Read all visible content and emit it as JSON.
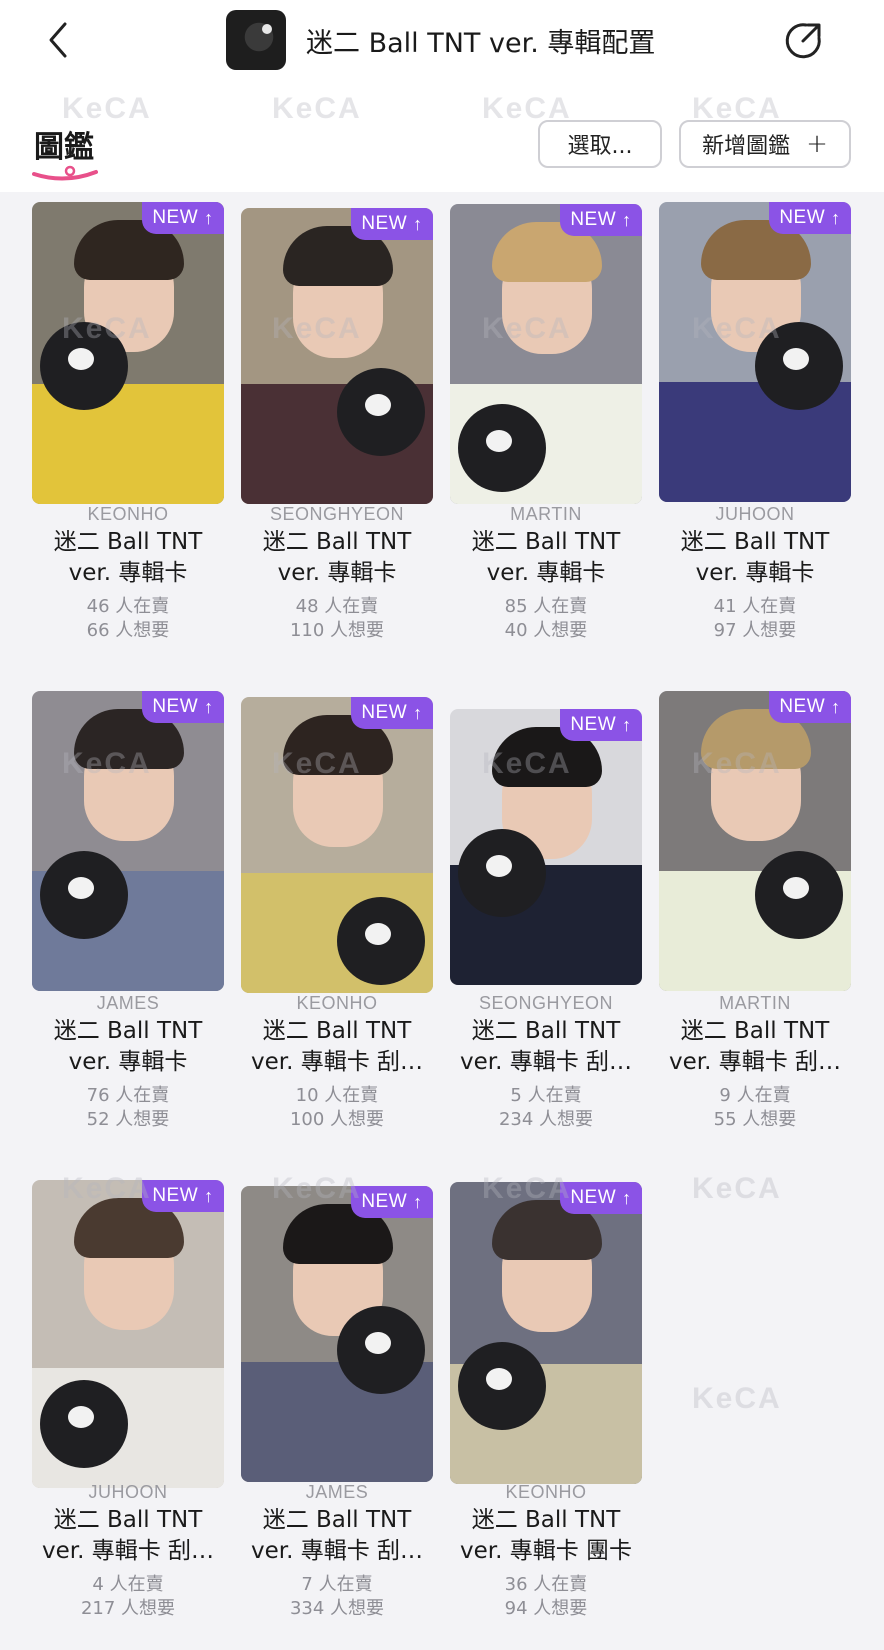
{
  "header": {
    "title": "迷二 Ball TNT ver. 專輯配置"
  },
  "toolbar": {
    "tab_label": "圖鑑",
    "select_label": "選取...",
    "add_label": "新增圖鑑",
    "add_symbol": "+"
  },
  "badge": {
    "text": "NEW",
    "arrow": "↑"
  },
  "watermark": "KeCA",
  "cards": [
    {
      "member": "KEONHO",
      "title1": "迷二 Ball TNT",
      "title2": "ver. 專輯卡",
      "selling": "46 人在賣",
      "wanting": "66 人想要"
    },
    {
      "member": "SEONGHYEON",
      "title1": "迷二 Ball TNT",
      "title2": "ver. 專輯卡",
      "selling": "48 人在賣",
      "wanting": "110 人想要"
    },
    {
      "member": "MARTIN",
      "title1": "迷二 Ball TNT",
      "title2": "ver. 專輯卡",
      "selling": "85 人在賣",
      "wanting": "40 人想要"
    },
    {
      "member": "JUHOON",
      "title1": "迷二 Ball TNT",
      "title2": "ver. 專輯卡",
      "selling": "41 人在賣",
      "wanting": "97 人想要"
    },
    {
      "member": "JAMES",
      "title1": "迷二 Ball TNT",
      "title2": "ver. 專輯卡",
      "selling": "76 人在賣",
      "wanting": "52 人想要"
    },
    {
      "member": "KEONHO",
      "title1": "迷二 Ball TNT",
      "title2": "ver. 專輯卡 刮…",
      "selling": "10 人在賣",
      "wanting": "100 人想要"
    },
    {
      "member": "SEONGHYEON",
      "title1": "迷二 Ball TNT",
      "title2": "ver. 專輯卡 刮…",
      "selling": "5 人在賣",
      "wanting": "234 人想要"
    },
    {
      "member": "MARTIN",
      "title1": "迷二 Ball TNT",
      "title2": "ver. 專輯卡 刮…",
      "selling": "9 人在賣",
      "wanting": "55 人想要"
    },
    {
      "member": "JUHOON",
      "title1": "迷二 Ball TNT",
      "title2": "ver. 專輯卡 刮…",
      "selling": "4 人在賣",
      "wanting": "217 人想要"
    },
    {
      "member": "JAMES",
      "title1": "迷二 Ball TNT",
      "title2": "ver. 專輯卡 刮…",
      "selling": "7 人在賣",
      "wanting": "334 人想要"
    },
    {
      "member": "KEONHO",
      "title1": "迷二 Ball TNT",
      "title2": "ver. 專輯卡 團卡",
      "selling": "36 人在賣",
      "wanting": "94 人想要"
    }
  ],
  "colors": {
    "badge": "#8b53e6",
    "underline": "#e8508a"
  }
}
